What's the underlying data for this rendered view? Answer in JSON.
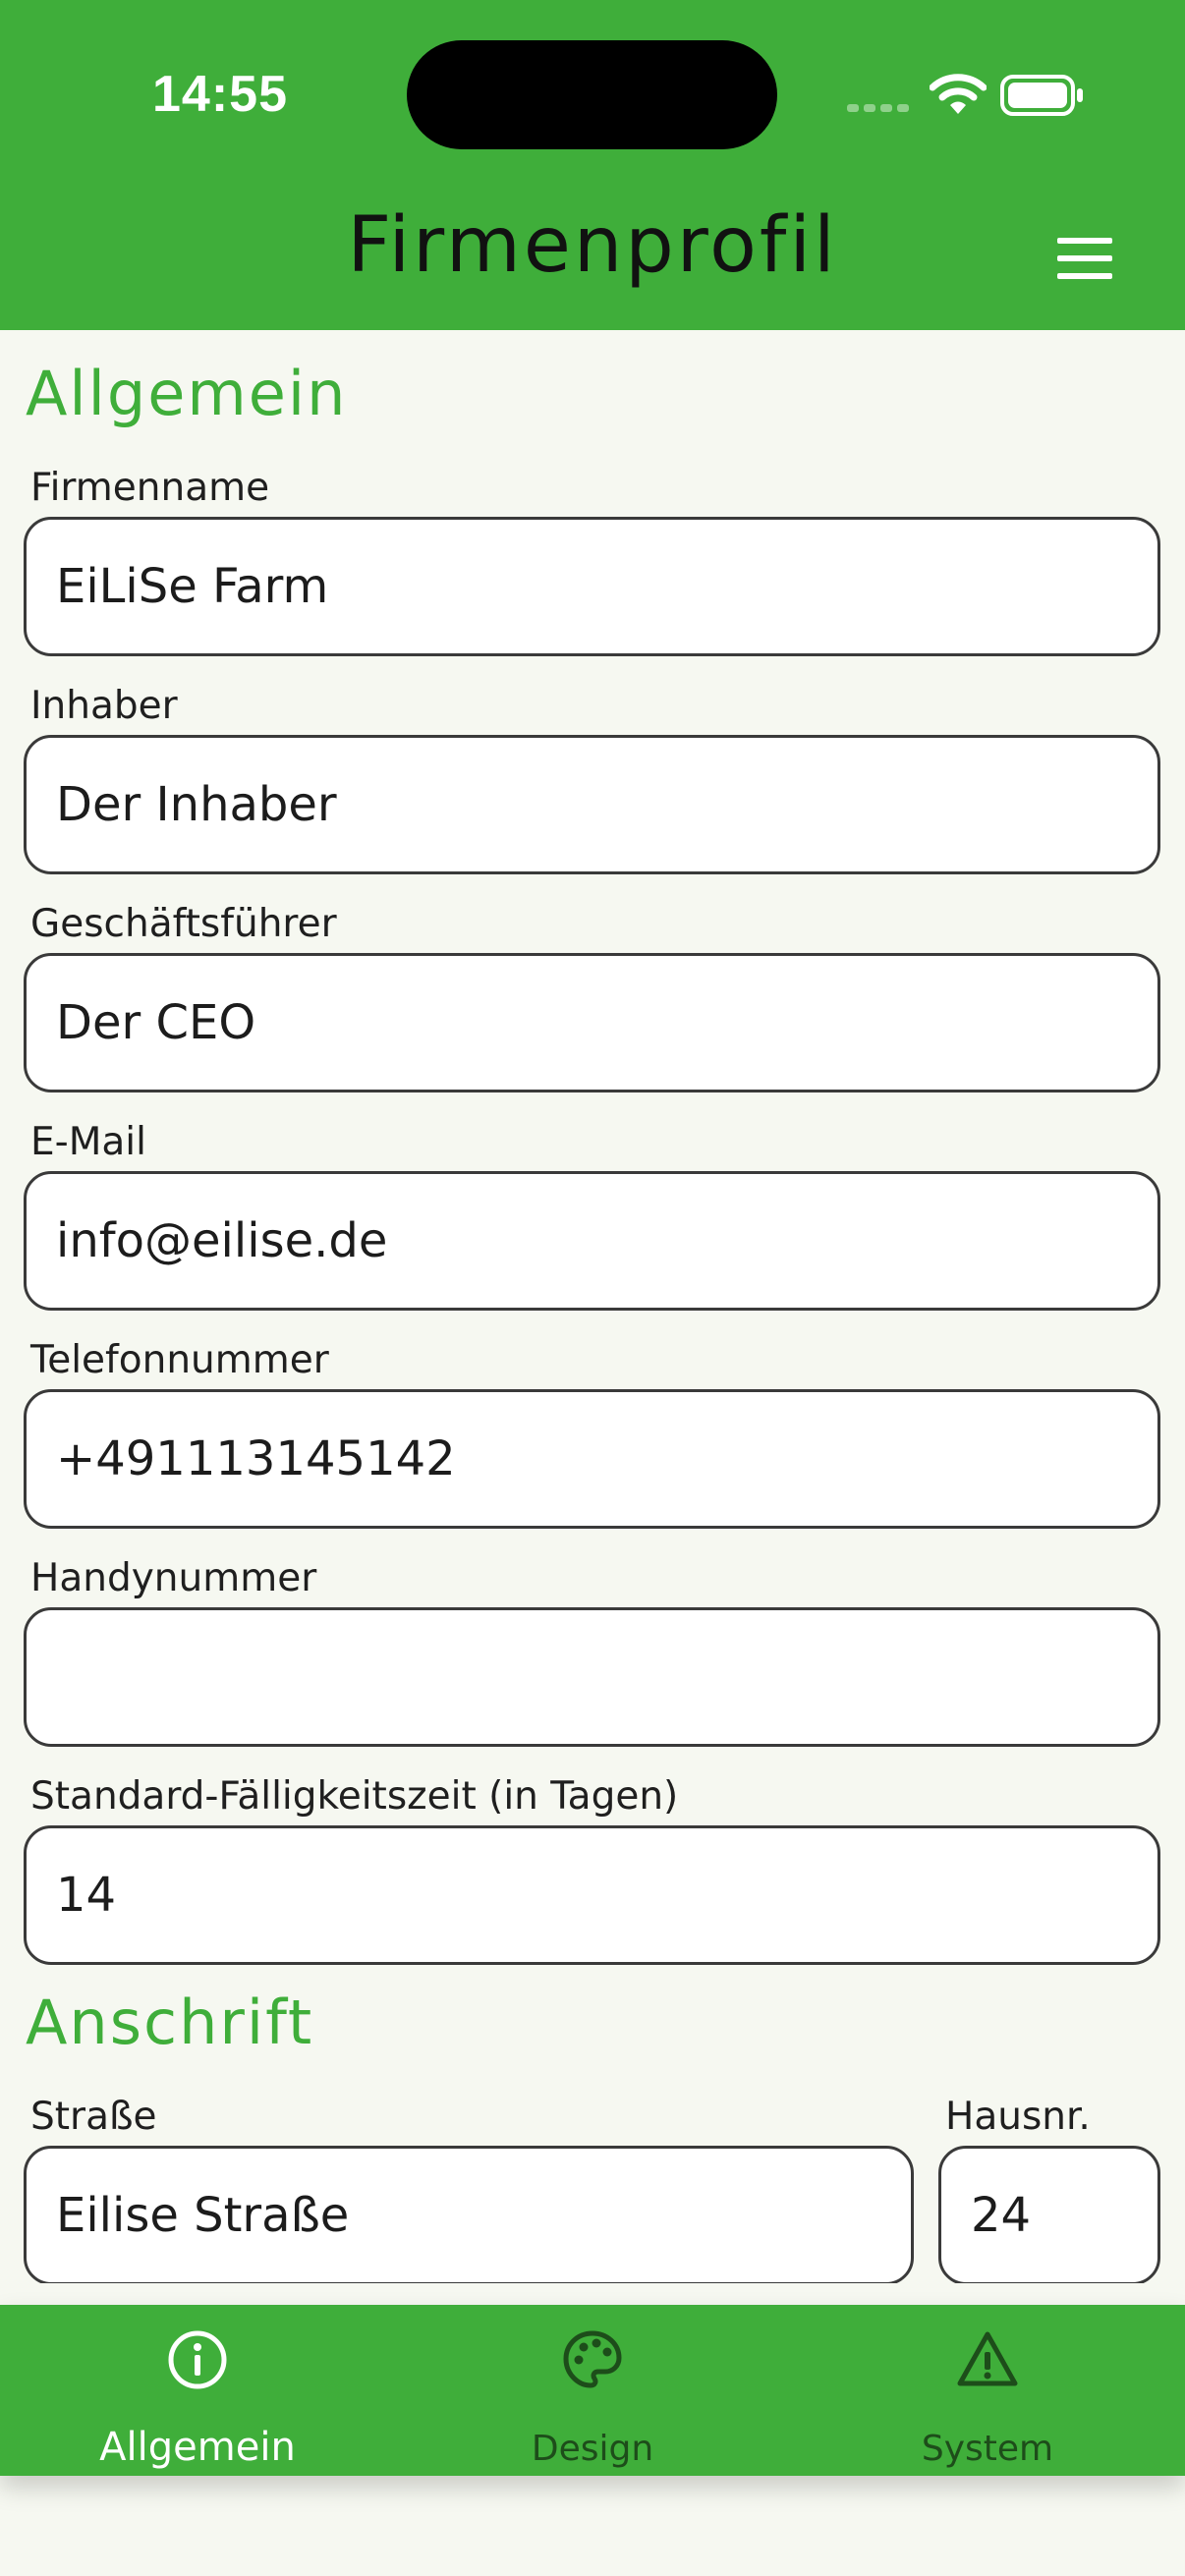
{
  "status_bar": {
    "time": "14:55"
  },
  "header": {
    "title": "Firmenprofil",
    "menu_icon": "hamburger-menu-icon"
  },
  "colors": {
    "primary": "#3fae3a",
    "background": "#f6f8f1",
    "tab_inactive": "#1d4d1a"
  },
  "sections": {
    "general": {
      "title": "Allgemein",
      "fields": {
        "company_name": {
          "label": "Firmenname",
          "value": "EiLiSe Farm"
        },
        "owner": {
          "label": "Inhaber",
          "value": "Der Inhaber"
        },
        "managing_director": {
          "label": "Geschäftsführer",
          "value": "Der CEO"
        },
        "email": {
          "label": "E-Mail",
          "value": "info@eilise.de"
        },
        "phone": {
          "label": "Telefonnummer",
          "value": "+491113145142"
        },
        "mobile": {
          "label": "Handynummer",
          "value": ""
        },
        "due_days": {
          "label": "Standard-Fälligkeitszeit (in Tagen)",
          "value": "14"
        }
      }
    },
    "address": {
      "title": "Anschrift",
      "fields": {
        "street": {
          "label": "Straße",
          "value": "Eilise Straße"
        },
        "house_number": {
          "label": "Hausnr.",
          "value": "24"
        }
      }
    }
  },
  "tabbar": {
    "tabs": [
      {
        "label": "Allgemein",
        "icon": "info-circle-icon",
        "active": true
      },
      {
        "label": "Design",
        "icon": "palette-icon",
        "active": false
      },
      {
        "label": "System",
        "icon": "warning-triangle-icon",
        "active": false
      }
    ]
  }
}
